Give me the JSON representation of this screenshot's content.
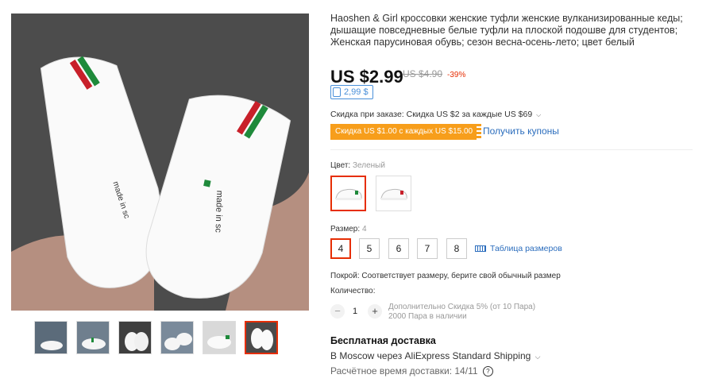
{
  "product": {
    "title": "Haoshen & Girl кроссовки женские туфли женские вулканизированные кеды; дышащие повседневные белые туфли на плоской подошве для студентов; Женская парусиновая обувь; сезон весна-осень-лето; цвет белый",
    "price": "US $2.99",
    "old_price": "US $4.90",
    "discount": "-39%",
    "coins": "2,99 $"
  },
  "gallery": {
    "main_image_alt": "made in sc",
    "thumbnails": [
      "thumb-1",
      "thumb-2",
      "thumb-3",
      "thumb-4",
      "thumb-5",
      "thumb-6"
    ],
    "selected_index": 5
  },
  "promo": {
    "order_discount": "Скидка при заказе: Скидка US $2 за каждые US $69",
    "coupon": "Скидка US $1.00 с каждых US $15.00",
    "get_coupons": "Получить купоны"
  },
  "color": {
    "label": "Цвет:",
    "value": "Зеленый",
    "options": [
      "green",
      "red"
    ]
  },
  "size": {
    "label": "Размер:",
    "value": "4",
    "options": [
      "4",
      "5",
      "6",
      "7",
      "8"
    ],
    "chart_link": "Таблица размеров"
  },
  "fit": "Покрой: Соответствует размеру, берите свой обычный размер",
  "quantity": {
    "label": "Количество:",
    "value": "1",
    "minus": "−",
    "plus": "+",
    "note_line1": "Дополнительно Скидка 5% (от 10 Пара)",
    "note_line2": "2000 Пара в наличии"
  },
  "shipping": {
    "title": "Бесплатная доставка",
    "route": "В Moscow через AliExpress Standard Shipping",
    "time": "Расчётное время доставки: 14/11",
    "help": "?"
  },
  "colors": {
    "accent": "#e62e04",
    "coupon_bg": "#f79e1b",
    "link": "#2b6dbd",
    "stripe_green": "#1f8a3b",
    "stripe_red": "#c8202a"
  }
}
